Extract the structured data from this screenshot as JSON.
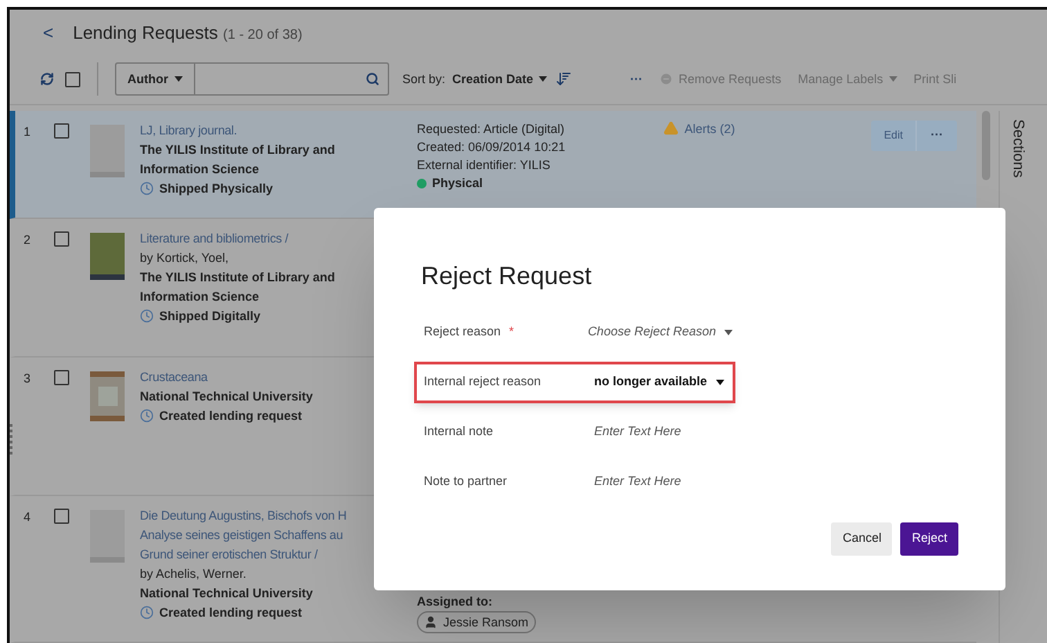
{
  "page": {
    "back": "<",
    "title": "Lending Requests",
    "count": "(1 - 20 of 38)"
  },
  "toolbar": {
    "search_field": "Author",
    "sort_label": "Sort by:",
    "sort_value": "Creation Date",
    "more": "···",
    "select_all_checked": false,
    "actions": [
      {
        "label": "Remove Requests",
        "kind": "remove"
      },
      {
        "label": "Manage Labels",
        "kind": "menu"
      },
      {
        "label": "Print Sli",
        "kind": "plain"
      }
    ]
  },
  "rows": [
    {
      "number": "1",
      "checked": false,
      "selected": true,
      "cover": {
        "kind": "blank"
      },
      "title_lines": [
        "LJ, Library journal."
      ],
      "author": "",
      "institution": "The YILIS Institute of Library and Information Science",
      "status": "Shipped Physically",
      "requested": "Requested: Article (Digital)",
      "created": "Created: 06/09/2014 10:21",
      "external": "External identifier: YILIS",
      "format": {
        "label": "Physical",
        "color": "#1f9d63"
      },
      "alerts": "Alerts (2)",
      "edit": "Edit",
      "more": "···"
    },
    {
      "number": "2",
      "checked": false,
      "selected": false,
      "cover": {
        "kind": "green"
      },
      "title_lines": [
        "Literature and bibliometrics /"
      ],
      "author": "by Kortick, Yoel,",
      "institution": "The YILIS Institute of Library and Information Science",
      "status": "Shipped Digitally"
    },
    {
      "number": "3",
      "checked": false,
      "selected": false,
      "cover": {
        "kind": "picture"
      },
      "title_lines": [
        "Crustaceana"
      ],
      "author": "",
      "institution": "National Technical University",
      "status": "Created lending request"
    },
    {
      "number": "4",
      "checked": false,
      "selected": false,
      "cover": {
        "kind": "blank"
      },
      "title_lines": [
        "Die Deutung Augustins, Bischofs von H",
        "Analyse seines geistigen Schaffens au",
        "Grund seiner erotischen Struktur /"
      ],
      "author": "by Achelis, Werner.",
      "institution": "National Technical University",
      "status": "Created lending request",
      "assigned_label": "Assigned to:",
      "assignee": "Jessie Ransom"
    }
  ],
  "side_tab": "Sections",
  "dialog": {
    "title": "Reject Request",
    "fields": [
      {
        "label": "Reject reason",
        "required_mark": "*",
        "kind": "select",
        "placeholder": "Choose Reject Reason",
        "highlighted": false
      },
      {
        "label": "Internal reject reason",
        "kind": "select",
        "value": "no longer available",
        "highlighted": true
      },
      {
        "label": "Internal note",
        "kind": "text",
        "placeholder": "Enter Text Here",
        "highlighted": false
      },
      {
        "label": "Note to partner",
        "kind": "text",
        "placeholder": "Enter Text Here",
        "highlighted": false
      }
    ],
    "buttons": [
      {
        "label": "Cancel",
        "primary": false
      },
      {
        "label": "Reject",
        "primary": true
      }
    ]
  }
}
